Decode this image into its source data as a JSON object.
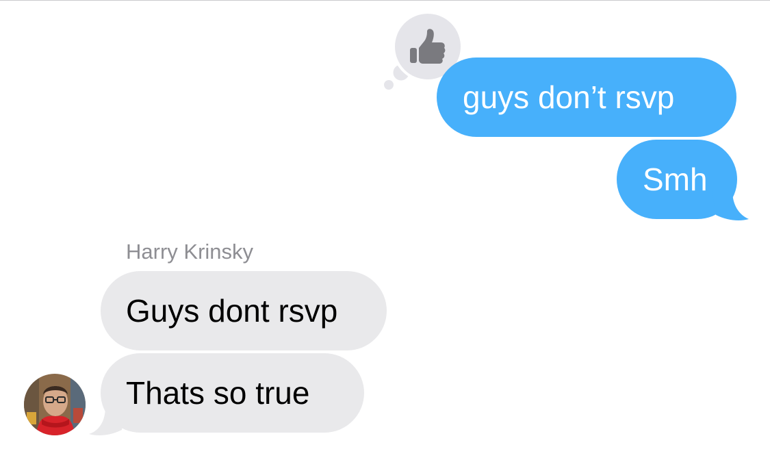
{
  "thread": {
    "outgoing": [
      {
        "text": "guys don’t rsvp",
        "reaction": "thumbs-up"
      },
      {
        "text": "Smh"
      }
    ],
    "incoming": {
      "sender_name": "Harry Krinsky",
      "messages": [
        {
          "text": "Guys dont rsvp"
        },
        {
          "text": "Thats so true"
        }
      ]
    }
  },
  "colors": {
    "outgoing_bubble": "#47b0fb",
    "incoming_bubble": "#e9e9eb",
    "tapback_bubble": "#e5e5ea",
    "tapback_icon": "#7a7a7f",
    "sender_name": "#8e8e93"
  }
}
